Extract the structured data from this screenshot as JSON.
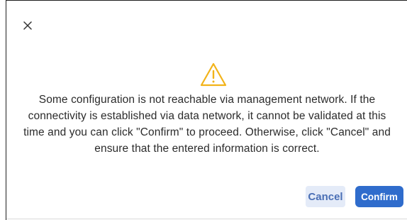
{
  "dialog": {
    "close_icon": "close-icon",
    "warning_icon": "warning-triangle-icon",
    "warning_color": "#f2b31a",
    "message_lines": [
      "Some configuration is not reachable via management network. If the",
      "connectivity is established via data network, it cannot be validated at this",
      "time and you can click \"Confirm\" to proceed. Otherwise, click \"Cancel\" and",
      "ensure that the entered information is correct."
    ],
    "cancel_label": "Cancel",
    "confirm_label": "Confirm",
    "accent_color": "#2f6ccc"
  }
}
